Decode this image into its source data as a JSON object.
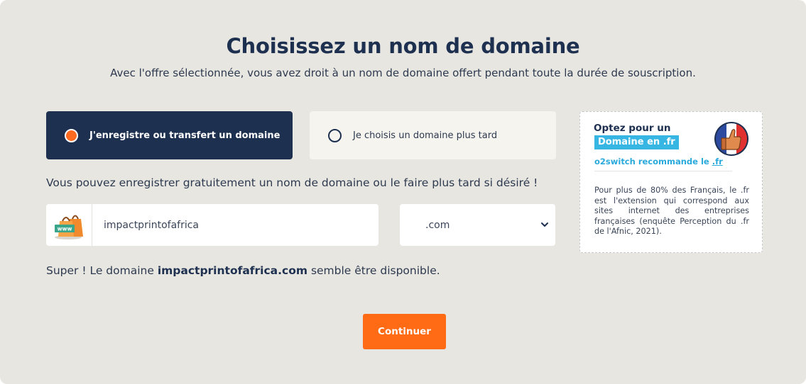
{
  "header": {
    "title": "Choisissez un nom de domaine",
    "subtitle": "Avec l'offre sélectionnée, vous avez droit à un nom de domaine offert pendant toute la durée de souscription."
  },
  "options": [
    {
      "label": "J'enregistre ou transfert un domaine",
      "selected": true
    },
    {
      "label": "Je choisis un domaine plus tard",
      "selected": false
    }
  ],
  "info_line": "Vous pouvez enregistrer gratuitement un nom de domaine ou le faire plus tard si désiré !",
  "domain_input": {
    "value": "impactprintofafrica",
    "icon": "www-shopping-bag-icon"
  },
  "extension_select": {
    "value": ".com",
    "icon": "chevron-down-icon"
  },
  "availability": {
    "prefix": "Super ! Le domaine ",
    "domain": "impactprintofafrica.com",
    "suffix": " semble être disponible."
  },
  "continue_label": "Continuer",
  "promo": {
    "heading": "Optez pour un",
    "tag": "Domaine en .fr",
    "reco_prefix": "o2switch recommande le ",
    "reco_link": ".fr",
    "text": "Pour plus de 80% des Français, le .fr est l'extension qui correspond aux sites internet des entreprises françaises (enquête Perception du .fr de l'Afnic, 2021).",
    "badge_icon": "thumbs-up-french-flag-icon"
  },
  "colors": {
    "background": "#e8e6e1",
    "navy": "#1e3050",
    "accent_orange": "#ff6a14",
    "promo_blue": "#38b6e3"
  }
}
